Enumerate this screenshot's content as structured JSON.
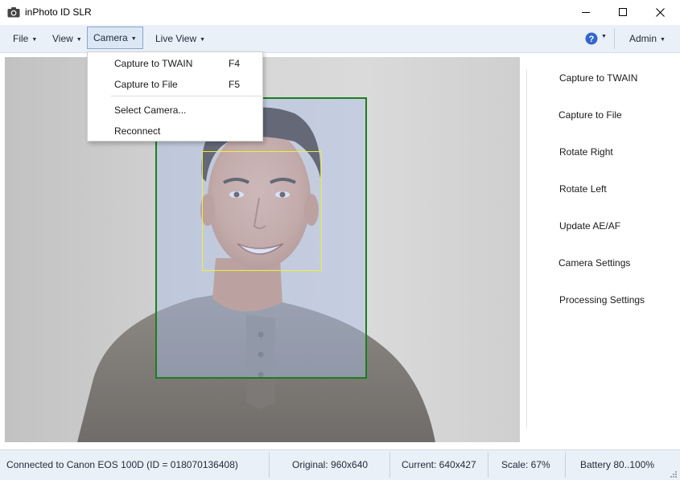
{
  "window": {
    "title": "inPhoto ID SLR",
    "icon": "camera-icon",
    "controls": [
      "minimize-icon",
      "maximize-icon",
      "close-icon"
    ]
  },
  "menubar": {
    "items": [
      {
        "label": "File"
      },
      {
        "label": "View"
      },
      {
        "label": "Camera",
        "active": true
      },
      {
        "label": "Live View"
      }
    ],
    "help_icon": "help-icon",
    "user": {
      "label": "Admin"
    }
  },
  "camera_menu": {
    "items": [
      {
        "label": "Capture to TWAIN",
        "shortcut": "F4"
      },
      {
        "label": "Capture to File",
        "shortcut": "F5"
      },
      {
        "label": "Select Camera...",
        "shortcut": ""
      },
      {
        "label": "Reconnect",
        "shortcut": ""
      }
    ]
  },
  "side_panel": {
    "buttons": [
      {
        "label": "Capture to TWAIN"
      },
      {
        "label": "Capture to File"
      },
      {
        "label": "Rotate Right"
      },
      {
        "label": "Rotate Left"
      },
      {
        "label": "Update AE/AF"
      },
      {
        "label": "Camera Settings"
      },
      {
        "label": "Processing Settings"
      }
    ]
  },
  "status": {
    "connection": "Connected to Canon EOS 100D (ID = 018070136408)",
    "original": "Original: 960x640",
    "current": "Current: 640x427",
    "scale": "Scale: 67%",
    "battery": "Battery 80..100%"
  },
  "colors": {
    "menubar_bg": "#eaf0f8",
    "crop_frame": "#1a7f1a",
    "face_frame": "#eef03a",
    "help_icon": "#3366cc"
  }
}
